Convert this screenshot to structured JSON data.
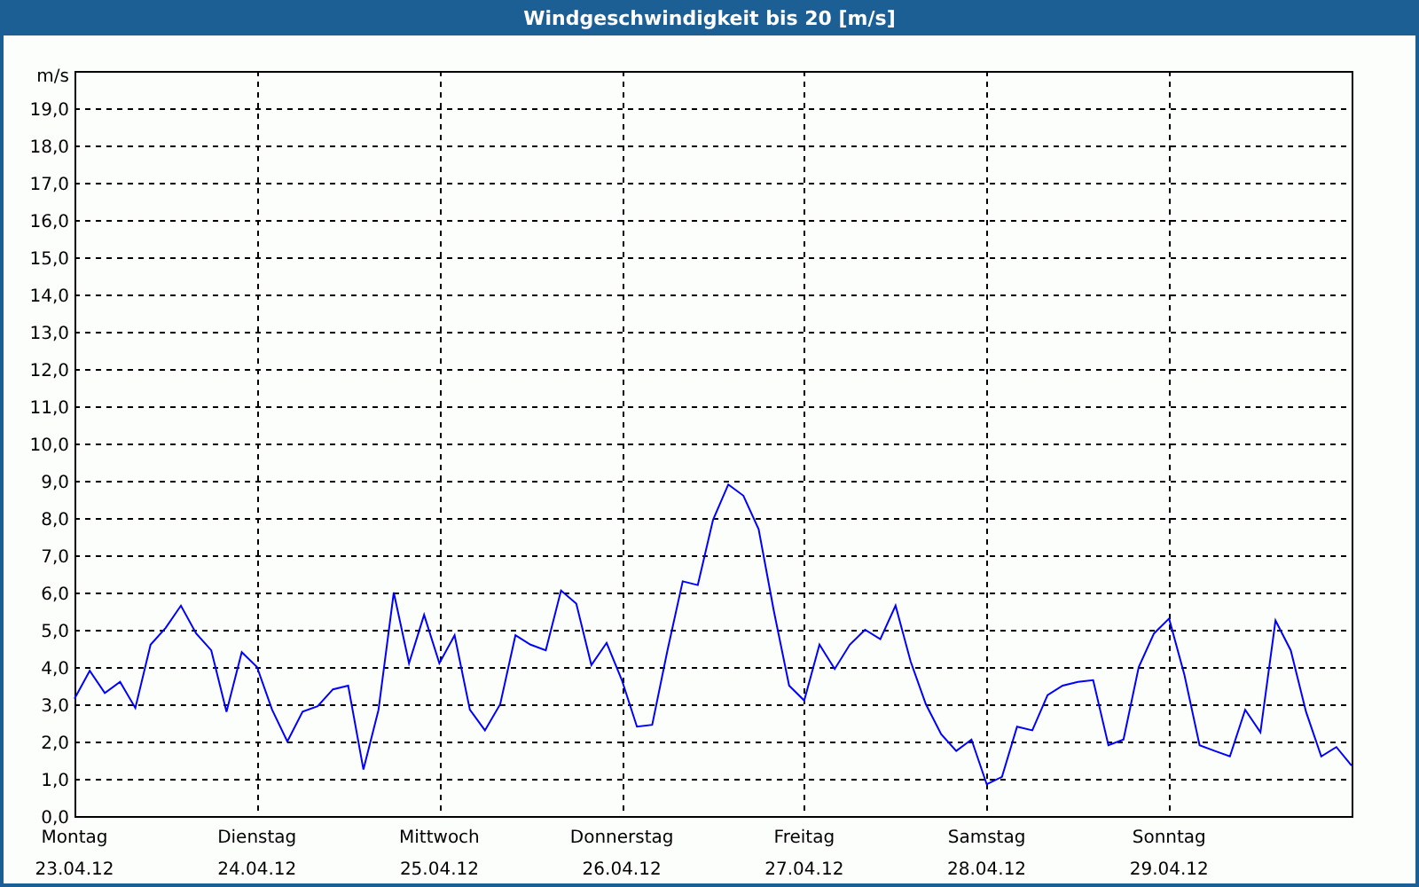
{
  "window": {
    "title": "Windgeschwindigkeit bis 20 [m/s]"
  },
  "chart": {
    "dates": [
      "23.04.12",
      "24.04.12",
      "25.04.12",
      "26.04.12",
      "27.04.12",
      "28.04.12",
      "29.04.12"
    ],
    "chart_data": {
      "type": "line",
      "ylabel": "m/s",
      "ylim": [
        0,
        20
      ],
      "grid": true,
      "yticks": [
        {
          "value": 0,
          "label": "0,0"
        },
        {
          "value": 1,
          "label": "1,0"
        },
        {
          "value": 2,
          "label": "2,0"
        },
        {
          "value": 3,
          "label": "3,0"
        },
        {
          "value": 4,
          "label": "4,0"
        },
        {
          "value": 5,
          "label": "5,0"
        },
        {
          "value": 6,
          "label": "6,0"
        },
        {
          "value": 7,
          "label": "7,0"
        },
        {
          "value": 8,
          "label": "8,0"
        },
        {
          "value": 9,
          "label": "9,0"
        },
        {
          "value": 10,
          "label": "10,0"
        },
        {
          "value": 11,
          "label": "11,0"
        },
        {
          "value": 12,
          "label": "12,0"
        },
        {
          "value": 13,
          "label": "13,0"
        },
        {
          "value": 14,
          "label": "14,0"
        },
        {
          "value": 15,
          "label": "15,0"
        },
        {
          "value": 16,
          "label": "16,0"
        },
        {
          "value": 17,
          "label": "17,0"
        },
        {
          "value": 18,
          "label": "18,0"
        },
        {
          "value": 19,
          "label": "19,0"
        }
      ],
      "categories": [
        "Montag",
        null,
        null,
        null,
        null,
        null,
        null,
        null,
        null,
        null,
        null,
        null,
        "Dienstag",
        null,
        null,
        null,
        null,
        null,
        null,
        null,
        null,
        null,
        null,
        null,
        "Mittwoch",
        null,
        null,
        null,
        null,
        null,
        null,
        null,
        null,
        null,
        null,
        null,
        "Donnerstag",
        null,
        null,
        null,
        null,
        null,
        null,
        null,
        null,
        null,
        null,
        null,
        "Freitag",
        null,
        null,
        null,
        null,
        null,
        null,
        null,
        null,
        null,
        null,
        null,
        "Samstag",
        null,
        null,
        null,
        null,
        null,
        null,
        null,
        null,
        null,
        null,
        null,
        "Sonntag",
        null,
        null,
        null,
        null,
        null,
        null,
        null,
        null,
        null,
        null,
        null,
        null
      ],
      "series": [
        {
          "color": "#0000ff",
          "values": [
            3.15,
            3.9,
            3.3,
            3.6,
            2.9,
            4.6,
            5.05,
            5.65,
            4.9,
            4.45,
            2.8,
            4.4,
            4.0,
            2.85,
            2.0,
            2.8,
            2.95,
            3.4,
            3.5,
            1.25,
            2.85,
            6.0,
            4.1,
            5.4,
            4.1,
            4.85,
            2.85,
            2.3,
            3.0,
            4.85,
            4.6,
            4.45,
            6.05,
            5.7,
            4.05,
            4.65,
            3.65,
            2.4,
            2.45,
            4.45,
            6.3,
            6.2,
            7.95,
            8.9,
            8.6,
            7.7,
            5.5,
            3.5,
            3.1,
            4.6,
            3.95,
            4.6,
            5.0,
            4.75,
            5.65,
            4.15,
            3.0,
            2.2,
            1.75,
            2.05,
            0.85,
            1.05,
            2.4,
            2.3,
            3.25,
            3.5,
            3.6,
            3.65,
            1.9,
            2.05,
            4.0,
            4.9,
            5.3,
            3.8,
            1.9,
            1.75,
            1.6,
            2.85,
            2.25,
            5.25,
            4.45,
            2.8,
            1.6,
            1.85,
            1.35
          ]
        }
      ]
    }
  }
}
